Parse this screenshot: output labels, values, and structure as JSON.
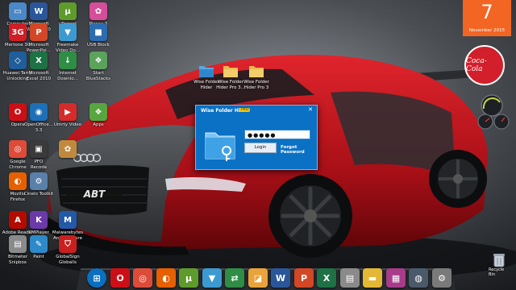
{
  "wallpaper": {
    "car_text": "ABT",
    "car_color": "#c4141c"
  },
  "desktop_icons": [
    {
      "label": "Computer",
      "glyph": "▭",
      "color": "#4a88c8",
      "icon": "computer-icon"
    },
    {
      "label": "Microsoft\nWord 2010",
      "glyph": "W",
      "color": "#2b579a",
      "icon": "word-icon"
    },
    {
      "label": "μTorrent",
      "glyph": "μ",
      "color": "#5e9b2c",
      "icon": "utorrent-icon"
    },
    {
      "label": "Picasa 3",
      "glyph": "✿",
      "color": "#d64e9a",
      "icon": "picasa-icon"
    },
    {
      "label": "Mertone 3G",
      "glyph": "3G",
      "color": "#cf1e26",
      "icon": "modem-3g-icon"
    },
    {
      "label": "Microsoft\nPowerPoi...",
      "glyph": "P",
      "color": "#d24726",
      "icon": "powerpoint-icon"
    },
    {
      "label": "Freemake\nVideo Do...",
      "glyph": "▼",
      "color": "#3d9ad1",
      "icon": "freemake-icon"
    },
    {
      "label": "USB Block",
      "glyph": "■",
      "color": "#2c6cb0",
      "icon": "usb-block-icon"
    },
    {
      "label": "Huawei Tamp\nUnlocking",
      "glyph": "◇",
      "color": "#1f5e9a",
      "icon": "huawei-icon"
    },
    {
      "label": "Microsoft\nExcel 2010",
      "glyph": "X",
      "color": "#1e7145",
      "icon": "excel-icon"
    },
    {
      "label": "Internet\nDownlo...",
      "glyph": "↓",
      "color": "#2f8d46",
      "icon": "idm-icon"
    },
    {
      "label": "Start\nBlueStacks",
      "glyph": "❖",
      "color": "#5ba35b",
      "icon": "bluestacks-icon"
    },
    {
      "label": "Opera",
      "glyph": "O",
      "color": "#cc0f16",
      "icon": "opera-icon"
    },
    {
      "label": "OpenOffice...\n3.3",
      "glyph": "◉",
      "color": "#1d6fb8",
      "icon": "openoffice-icon"
    },
    {
      "label": "Umrty Video",
      "glyph": "▶",
      "color": "#d62b2b",
      "icon": "video-icon"
    },
    {
      "label": "Apps",
      "glyph": "❖",
      "color": "#58a640",
      "icon": "apps-icon"
    },
    {
      "label": "Google\nChrome",
      "glyph": "◎",
      "color": "#dd4b39",
      "icon": "chrome-icon"
    },
    {
      "label": "PFO\nRecode",
      "glyph": "▣",
      "color": "#3a3a3a",
      "icon": "recode-icon"
    },
    {
      "label": "",
      "glyph": "✿",
      "color": "#c08a3e",
      "icon": "image-icon"
    },
    {
      "label": "Mozilla\nFirefox",
      "glyph": "◐",
      "color": "#e66000",
      "icon": "firefox-icon"
    },
    {
      "label": "Cinelo Toolkit",
      "glyph": "⚙",
      "color": "#5a7fa8",
      "icon": "toolkit-icon"
    },
    {
      "label": "Adobe Reader\nXI",
      "glyph": "A",
      "color": "#b30b00",
      "icon": "adobe-reader-icon"
    },
    {
      "label": "KMPlayer",
      "glyph": "K",
      "color": "#6b3aa8",
      "icon": "kmplayer-icon"
    },
    {
      "label": "Malwarebytes\nAnti-Malware",
      "glyph": "M",
      "color": "#2259a8",
      "icon": "malwarebytes-icon"
    },
    {
      "label": "Bitmeter\nSnipbox",
      "glyph": "▤",
      "color": "#8a8a8a",
      "icon": "bitmeter-icon"
    },
    {
      "label": "Paint",
      "glyph": "✎",
      "color": "#2d89c8",
      "icon": "paint-icon"
    },
    {
      "label": "GlobalSign\nGloballs",
      "glyph": "⛉",
      "color": "#c91f1f",
      "icon": "shield-icon"
    }
  ],
  "folders": [
    {
      "label": "Wise Folder\nHider",
      "icon": "wise-folder-hider-icon"
    },
    {
      "label": "Wise Folder\nHider Pro 3...",
      "icon": "folder-icon"
    },
    {
      "label": "Wise Folder\nHider Pro 3",
      "icon": "folder-icon"
    }
  ],
  "dialog": {
    "title": "Wise Folder Hider",
    "badge": "PRO",
    "close": "✕",
    "password_masked": "●●●●●",
    "login_label": "Login",
    "forgot_label": "Forgot Password"
  },
  "calendar": {
    "day": "7",
    "month_year": "November 2015"
  },
  "coke_gadget": {
    "text": "Coca-Cola"
  },
  "taskbar": [
    {
      "glyph": "⊞",
      "color": "#0a6fbf",
      "icon": "windows-start-icon"
    },
    {
      "glyph": "O",
      "color": "#cc0f16",
      "icon": "opera-icon"
    },
    {
      "glyph": "◎",
      "color": "#dd4b39",
      "icon": "chrome-icon"
    },
    {
      "glyph": "◐",
      "color": "#e66000",
      "icon": "firefox-icon"
    },
    {
      "glyph": "μ",
      "color": "#5e9b2c",
      "icon": "utorrent-icon"
    },
    {
      "glyph": "▼",
      "color": "#3d9ad1",
      "icon": "freemake-icon"
    },
    {
      "glyph": "⇄",
      "color": "#2f8d46",
      "icon": "internet-download-icon"
    },
    {
      "glyph": "◪",
      "color": "#e8a33a",
      "icon": "media-icon"
    },
    {
      "glyph": "W",
      "color": "#2b579a",
      "icon": "word-icon"
    },
    {
      "glyph": "P",
      "color": "#d24726",
      "icon": "powerpoint-icon"
    },
    {
      "glyph": "X",
      "color": "#1e7145",
      "icon": "excel-icon"
    },
    {
      "glyph": "▤",
      "color": "#8a8a8a",
      "icon": "calculator-icon"
    },
    {
      "glyph": "▬",
      "color": "#e4b735",
      "icon": "folder-icon"
    },
    {
      "glyph": "▦",
      "color": "#a83b8a",
      "icon": "winrar-icon"
    },
    {
      "glyph": "◍",
      "color": "#4a5a6a",
      "icon": "network-icon"
    },
    {
      "glyph": "⚙",
      "color": "#7a7a7a",
      "icon": "settings-icon"
    }
  ],
  "recycle_bin": {
    "label": "Recycle Bin"
  }
}
